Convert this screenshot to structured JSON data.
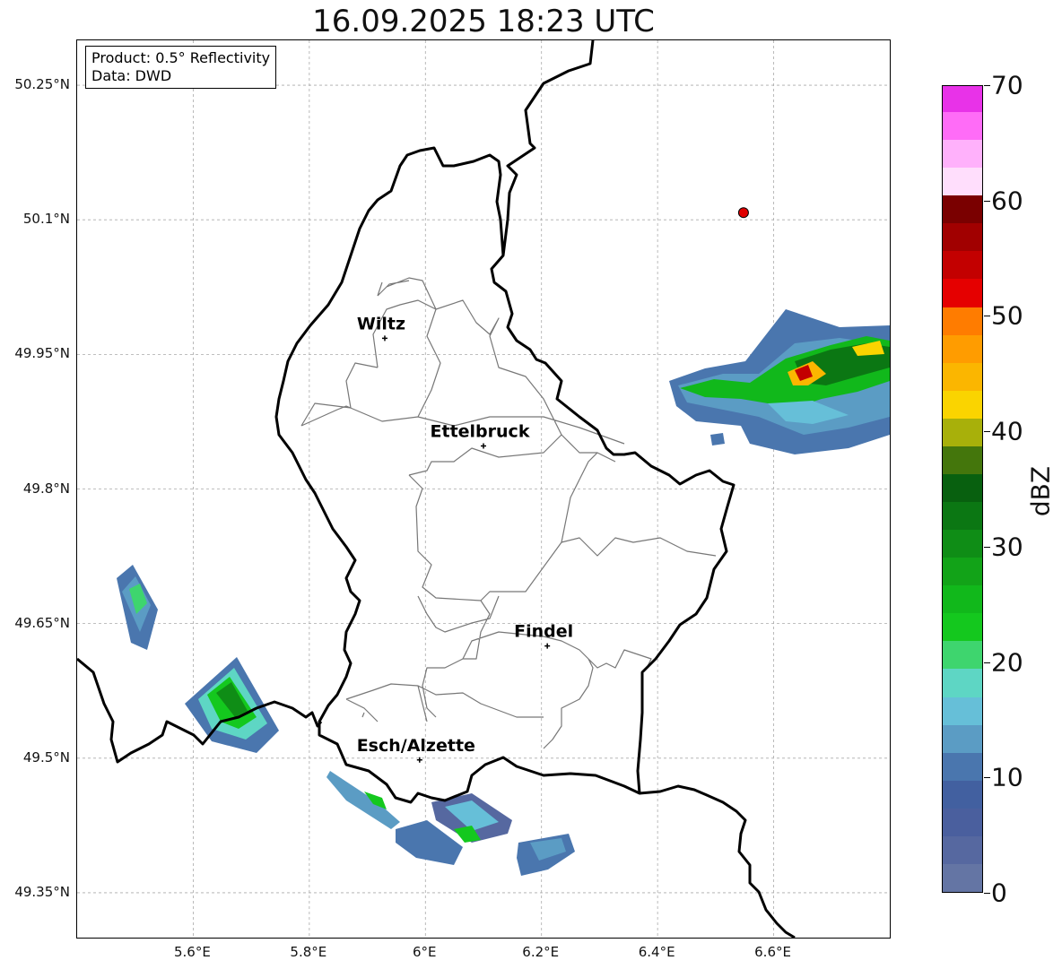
{
  "title": "16.09.2025 18:23 UTC",
  "info": {
    "product": "Product: 0.5° Reflectivity",
    "source": "Data: DWD"
  },
  "axes": {
    "lat_labels": [
      "50.25°N",
      "50.1°N",
      "49.95°N",
      "49.8°N",
      "49.65°N",
      "49.5°N",
      "49.35°N"
    ],
    "lat_values": [
      50.25,
      50.1,
      49.95,
      49.8,
      49.65,
      49.5,
      49.35
    ],
    "lon_labels": [
      "5.6°E",
      "5.8°E",
      "6°E",
      "6.2°E",
      "6.4°E",
      "6.6°E"
    ],
    "lon_values": [
      5.6,
      5.8,
      6.0,
      6.2,
      6.4,
      6.6
    ],
    "lon_range": [
      5.4,
      6.8
    ],
    "lat_range": [
      49.3,
      50.3
    ],
    "grid": true
  },
  "cities": [
    {
      "name": "Wiltz",
      "lon": 5.93,
      "lat": 49.968
    },
    {
      "name": "Ettelbruck",
      "lon": 6.1,
      "lat": 49.848
    },
    {
      "name": "Findel",
      "lon": 6.21,
      "lat": 49.625
    },
    {
      "name": "Esch/Alzette",
      "lon": 5.99,
      "lat": 49.498
    }
  ],
  "marker": {
    "lon": 6.548,
    "lat": 50.108,
    "color": "#e00000"
  },
  "colorbar": {
    "unit": "dBZ",
    "min": 0,
    "max": 70,
    "tick_values": [
      0,
      10,
      20,
      30,
      40,
      50,
      60,
      70
    ],
    "tick_labels": [
      "0",
      "10",
      "20",
      "30",
      "40",
      "50",
      "60",
      "70"
    ],
    "colors": [
      "#6475a4",
      "#5668a0",
      "#4a5f9e",
      "#4260a0",
      "#4a76ae",
      "#5b9cc4",
      "#66bfd8",
      "#5ed6c4",
      "#3ed56e",
      "#14c81e",
      "#11b81b",
      "#12a318",
      "#0f8d16",
      "#0b7713",
      "#08600f",
      "#44760c",
      "#a8b00a",
      "#fad400",
      "#fbb600",
      "#ff9c00",
      "#ff7c00",
      "#e50000",
      "#c30000",
      "#a10000",
      "#7a0000",
      "#ffdefc",
      "#ffb1fb",
      "#ff6cf7",
      "#e832e8"
    ]
  },
  "radar_cells": [
    {
      "lon": 5.49,
      "lat": 49.675,
      "dbz": 9
    },
    {
      "lon": 5.5,
      "lat": 49.69,
      "dbz": 18
    },
    {
      "lon": 5.505,
      "lat": 49.67,
      "dbz": 14
    },
    {
      "lon": 5.665,
      "lat": 49.565,
      "dbz": 28
    },
    {
      "lon": 5.69,
      "lat": 49.58,
      "dbz": 22
    },
    {
      "lon": 5.7,
      "lat": 49.55,
      "dbz": 14
    },
    {
      "lon": 5.64,
      "lat": 49.555,
      "dbz": 10
    },
    {
      "lon": 5.89,
      "lat": 49.455,
      "dbz": 12
    },
    {
      "lon": 6.06,
      "lat": 49.425,
      "dbz": 18
    },
    {
      "lon": 6.0,
      "lat": 49.405,
      "dbz": 10
    },
    {
      "lon": 6.21,
      "lat": 49.39,
      "dbz": 8
    },
    {
      "lon": 6.52,
      "lat": 49.925,
      "dbz": 24
    },
    {
      "lon": 6.64,
      "lat": 49.935,
      "dbz": 44
    },
    {
      "lon": 6.65,
      "lat": 49.935,
      "dbz": 54
    },
    {
      "lon": 6.76,
      "lat": 49.96,
      "dbz": 42
    },
    {
      "lon": 6.7,
      "lat": 49.9,
      "dbz": 18
    },
    {
      "lon": 6.61,
      "lat": 49.88,
      "dbz": 10
    }
  ]
}
